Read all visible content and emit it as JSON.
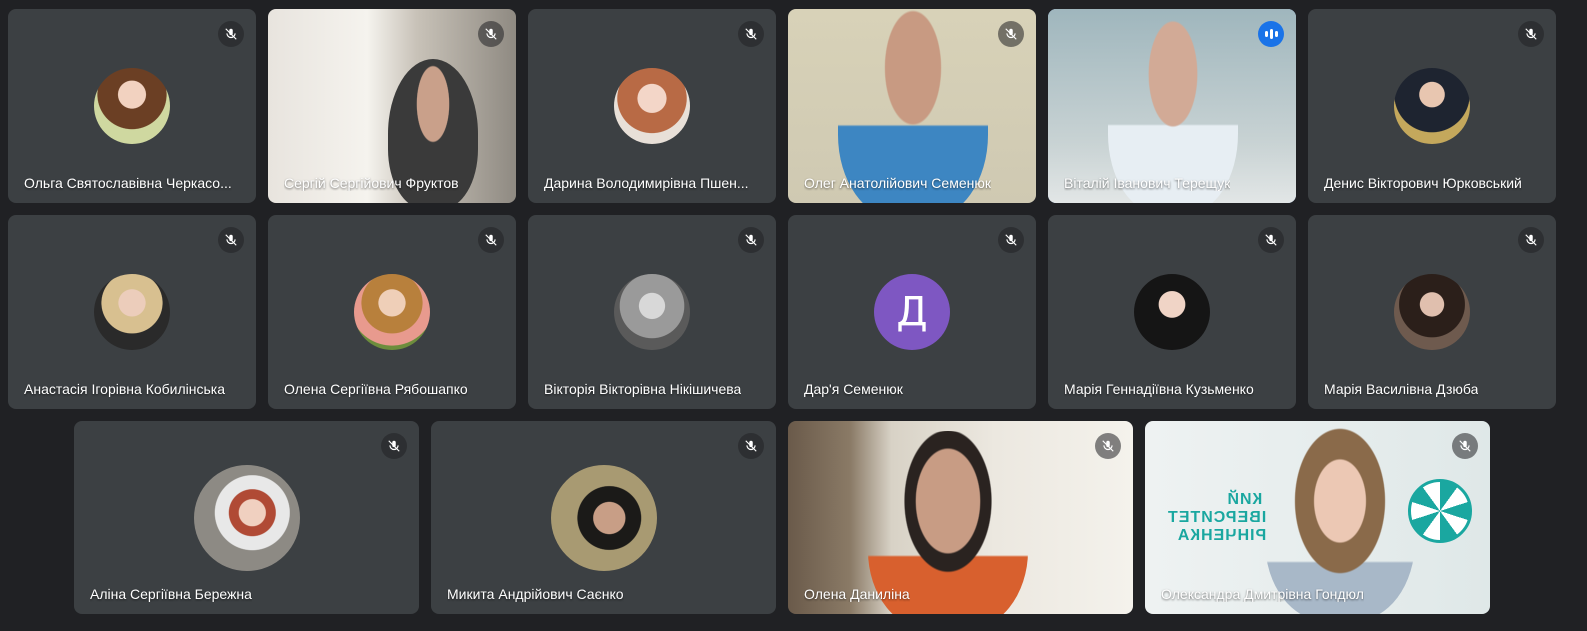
{
  "participants": [
    {
      "name": "Ольга Святославівна Черкасо...",
      "mic": "mic-off-icon",
      "type": "avatar"
    },
    {
      "name": "Сергій Сергійович Фруктов",
      "mic": "mic-off-icon",
      "type": "video"
    },
    {
      "name": "Дарина Володимирівна Пшен...",
      "mic": "mic-off-icon",
      "type": "avatar"
    },
    {
      "name": "Олег Анатолійович Семенюк",
      "mic": "mic-off-icon",
      "type": "video"
    },
    {
      "name": "Віталій Іванович Терещук",
      "mic": "speaking-indicator-icon",
      "type": "video"
    },
    {
      "name": "Денис Вікторович Юрковський",
      "mic": "mic-off-icon",
      "type": "avatar"
    },
    {
      "name": "Анастасія Ігорівна Кобилінська",
      "mic": "mic-off-icon",
      "type": "avatar"
    },
    {
      "name": "Олена Сергіївна Рябошапко",
      "mic": "mic-off-icon",
      "type": "avatar"
    },
    {
      "name": "Вікторія Вікторівна Нікішичева",
      "mic": "mic-off-icon",
      "type": "avatar"
    },
    {
      "name": "Дар'я Семенюк",
      "mic": "mic-off-icon",
      "type": "letter",
      "letter": "Д"
    },
    {
      "name": "Марія Геннадіївна Кузьменко",
      "mic": "mic-off-icon",
      "type": "avatar"
    },
    {
      "name": "Марія Василівна Дзюба",
      "mic": "mic-off-icon",
      "type": "avatar"
    },
    {
      "name": "Аліна Сергіївна Бережна",
      "mic": "mic-off-icon",
      "type": "avatar"
    },
    {
      "name": "Микита Андрійович Саєнко",
      "mic": "mic-off-icon",
      "type": "avatar"
    },
    {
      "name": "Олена Даниліна",
      "mic": "mic-off-icon",
      "type": "video"
    },
    {
      "name": "Олександра Дмитрівна Гондюл",
      "mic": "mic-off-icon",
      "type": "video"
    }
  ],
  "background_text": [
    "КИЙ",
    "ІВЕРСИТЕТ",
    "РІНЧЕНКА"
  ],
  "colors": {
    "background": "#202124",
    "tile": "#3c4043",
    "speaking_outline": "#8ab4f8",
    "speaking_badge": "#1a73e8",
    "letter_avatar": "#7e57c2"
  }
}
